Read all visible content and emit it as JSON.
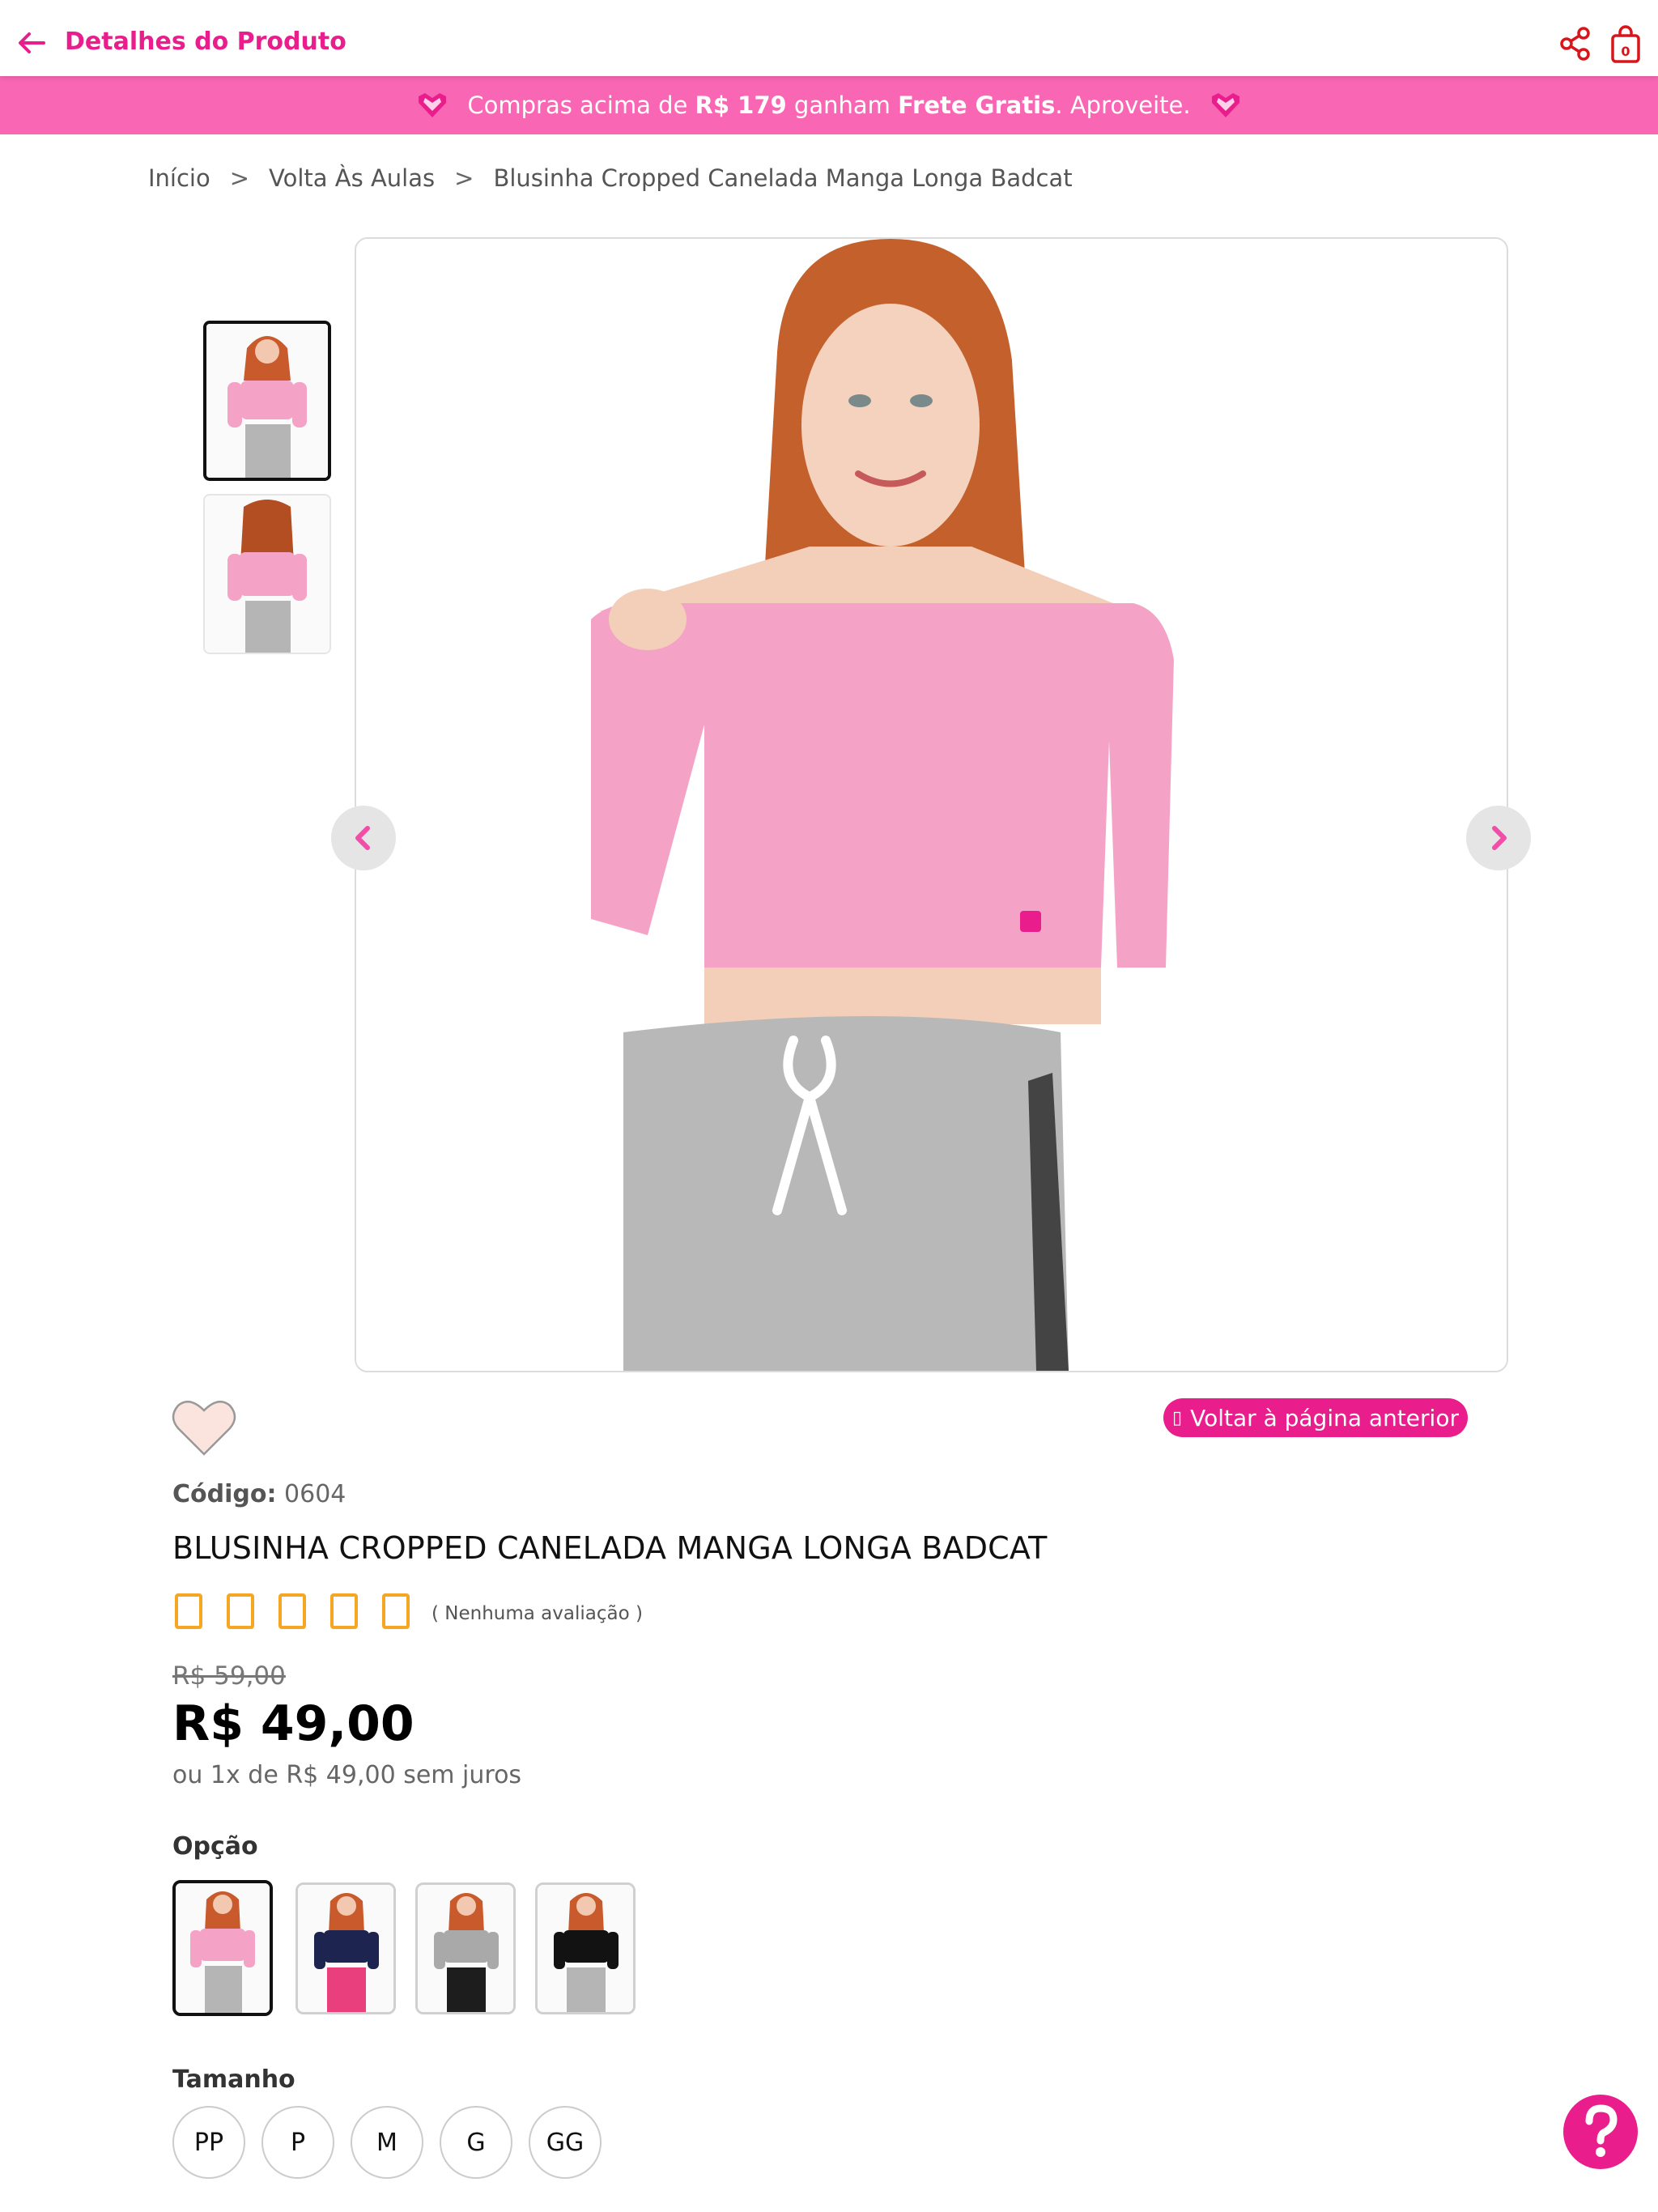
{
  "header": {
    "title": "Detalhes do Produto"
  },
  "promo": {
    "prefix": "Compras acima de",
    "amount": "R$ 179",
    "middle": "ganham",
    "highlight": "Frete Gratis",
    "suffix": ". Aproveite."
  },
  "breadcrumb": {
    "items": [
      "Início",
      "Volta Às Aulas",
      "Blusinha Cropped Canelada Manga Longa Badcat"
    ],
    "separator": ">"
  },
  "gallery": {
    "thumbnails": [
      "front-pink",
      "back-pink"
    ],
    "selected_index": 0
  },
  "actions": {
    "back_page": "Voltar à página anterior"
  },
  "product": {
    "code_label": "Código:",
    "code": "0604",
    "title": "BLUSINHA CROPPED CANELADA MANGA LONGA BADCAT",
    "rating_text": "( Nenhuma avaliação )",
    "rating_stars": 0,
    "rating_max": 5,
    "old_price": "R$ 59,00",
    "price": "R$ 49,00",
    "installments": "ou 1x de R$ 49,00 sem juros"
  },
  "options": {
    "label": "Opção",
    "items": [
      {
        "name": "rosa",
        "top": "#f4a3c6",
        "bottom": "#b5b5b5"
      },
      {
        "name": "marinho",
        "top": "#1e2450",
        "bottom": "#e9407d"
      },
      {
        "name": "cinza",
        "top": "#a9a9a9",
        "bottom": "#1d1d1d"
      },
      {
        "name": "preto",
        "top": "#121212",
        "bottom": "#b5b5b5"
      }
    ],
    "selected_index": 0
  },
  "sizes": {
    "label": "Tamanho",
    "items": [
      "PP",
      "P",
      "M",
      "G",
      "GG"
    ]
  },
  "colors": {
    "brand": "#e91e8c",
    "banner": "#f866b4",
    "star": "#f5a623"
  }
}
